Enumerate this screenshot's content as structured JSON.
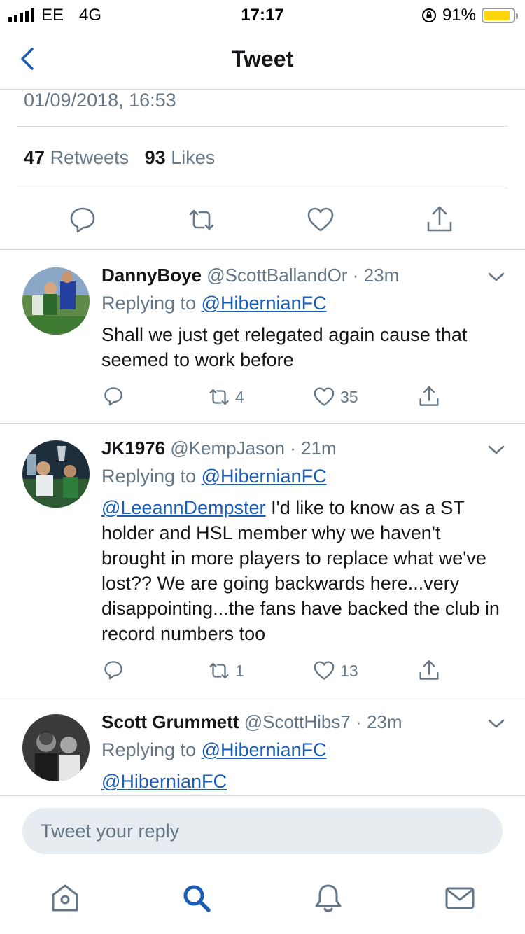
{
  "status_bar": {
    "carrier": "EE",
    "network": "4G",
    "time": "17:17",
    "battery_percent": "91%",
    "battery_level": 0.91
  },
  "nav": {
    "title": "Tweet"
  },
  "tweet": {
    "timestamp": "01/09/2018, 16:53",
    "retweets_count": "47",
    "retweets_label": "Retweets",
    "likes_count": "93",
    "likes_label": "Likes"
  },
  "replies": [
    {
      "name": "DannyBoye",
      "handle": "@ScottBallandOr",
      "time": "23m",
      "replying_prefix": "Replying to",
      "replying_to": "@HibernianFC",
      "mention": "",
      "text": "Shall we just get relegated again cause that seemed to work before",
      "retweets": "4",
      "likes": "35"
    },
    {
      "name": "JK1976",
      "handle": "@KempJason",
      "time": "21m",
      "replying_prefix": "Replying to",
      "replying_to": "@HibernianFC",
      "mention": "@LeeannDempster",
      "text": "I'd like to know as a ST holder and HSL member why we haven't brought in more players to replace what we've lost?? We are going backwards here...very disappointing...the fans have backed the club in record numbers too",
      "retweets": "1",
      "likes": "13"
    },
    {
      "name": "Scott Grummett",
      "handle": "@ScottHibs7",
      "time": "23m",
      "replying_prefix": "Replying to",
      "replying_to": "@HibernianFC",
      "mention": "@HibernianFC",
      "text": ""
    }
  ],
  "reply_box": {
    "placeholder": "Tweet your reply"
  },
  "tabs": [
    "home-icon",
    "search-icon",
    "notifications-icon",
    "messages-icon"
  ],
  "colors": {
    "accent": "#1da1f2",
    "link": "#1b5db5",
    "secondary_text": "#657786",
    "nav_active": "#1b5db5"
  }
}
